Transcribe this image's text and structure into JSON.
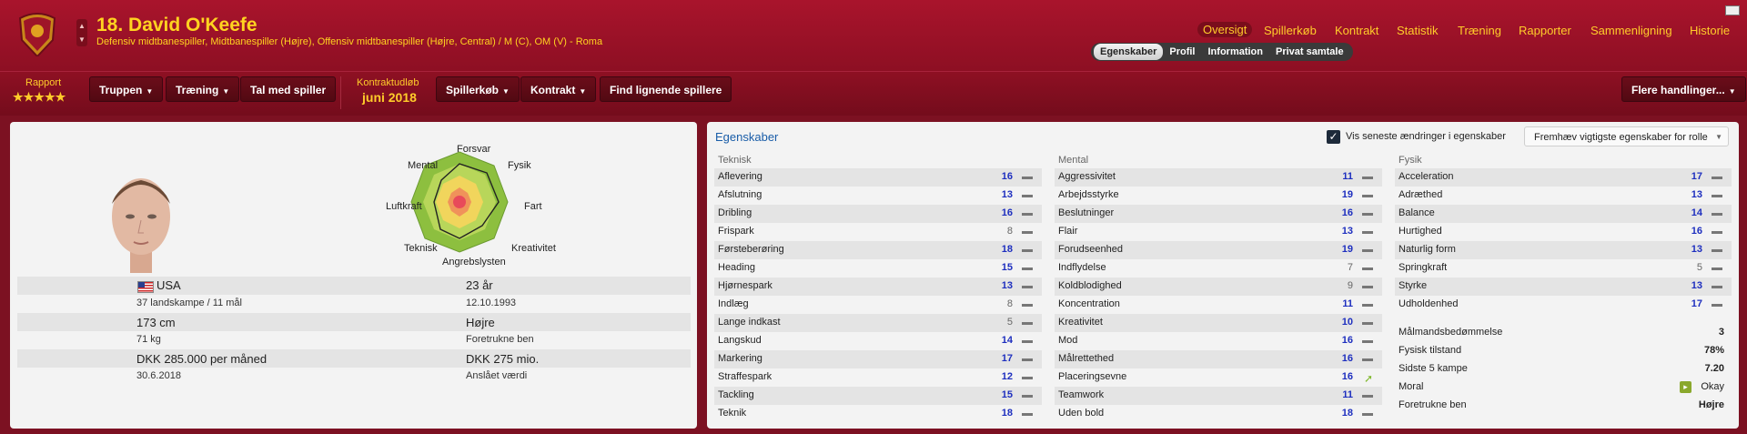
{
  "header": {
    "player_name": "18. David O'Keefe",
    "positions": "Defensiv midtbanespiller, Midtbanespiller (Højre), Offensiv midtbanespiller (Højre, Central) / M (C), OM (V) - Roma",
    "nav": [
      "Oversigt",
      "Spillerkøb",
      "Kontrakt",
      "Statistik",
      "Træning",
      "Rapporter",
      "Sammenligning",
      "Historie"
    ],
    "active_nav": "Oversigt",
    "subtabs": [
      "Egenskaber",
      "Profil",
      "Information",
      "Privat samtale"
    ],
    "active_subtab": "Egenskaber"
  },
  "action_bar": {
    "rapport_label": "Rapport",
    "rapport_stars": "★★★★★",
    "buttons_left": [
      "Truppen",
      "Træning",
      "Tal med spiller"
    ],
    "kontrakt_label": "Kontraktudløb",
    "kontrakt_value": "juni 2018",
    "buttons_right": [
      "Spillerkøb",
      "Kontrakt",
      "Find lignende spillere"
    ],
    "more_actions": "Flere handlinger..."
  },
  "profile": {
    "radar_labels": [
      "Forsvar",
      "Fysik",
      "Fart",
      "Kreativitet",
      "Angrebslysten",
      "Teknisk",
      "Luftkraft",
      "Mental"
    ],
    "nationality": "USA",
    "caps": "37 landskampe / 11 mål",
    "age": "23 år",
    "birthdate": "12.10.1993",
    "height": "173 cm",
    "weight": "71 kg",
    "foot": "Højre",
    "foot_label": "Foretrukne ben",
    "wage": "DKK 285.000 per måned",
    "contract_end": "30.6.2018",
    "value": "DKK 275 mio.",
    "value_label": "Anslået værdi"
  },
  "attributes": {
    "title": "Egenskaber",
    "show_changes": "Vis seneste ændringer i egenskaber",
    "highlight": "Fremhæv vigtigste egenskaber for rolle",
    "teknisk_header": "Teknisk",
    "mental_header": "Mental",
    "fysik_header": "Fysik",
    "teknisk": [
      {
        "name": "Aflevering",
        "value": "16"
      },
      {
        "name": "Afslutning",
        "value": "13"
      },
      {
        "name": "Dribling",
        "value": "16"
      },
      {
        "name": "Frispark",
        "value": "8"
      },
      {
        "name": "Førsteberøring",
        "value": "18"
      },
      {
        "name": "Heading",
        "value": "15"
      },
      {
        "name": "Hjørnespark",
        "value": "13"
      },
      {
        "name": "Indlæg",
        "value": "8"
      },
      {
        "name": "Lange indkast",
        "value": "5"
      },
      {
        "name": "Langskud",
        "value": "14"
      },
      {
        "name": "Markering",
        "value": "17"
      },
      {
        "name": "Straffespark",
        "value": "12"
      },
      {
        "name": "Tackling",
        "value": "15"
      },
      {
        "name": "Teknik",
        "value": "18"
      }
    ],
    "mental": [
      {
        "name": "Aggressivitet",
        "value": "11"
      },
      {
        "name": "Arbejdsstyrke",
        "value": "19"
      },
      {
        "name": "Beslutninger",
        "value": "16"
      },
      {
        "name": "Flair",
        "value": "13"
      },
      {
        "name": "Forudseenhed",
        "value": "19"
      },
      {
        "name": "Indflydelse",
        "value": "7"
      },
      {
        "name": "Koldblodighed",
        "value": "9"
      },
      {
        "name": "Koncentration",
        "value": "11"
      },
      {
        "name": "Kreativitet",
        "value": "10"
      },
      {
        "name": "Mod",
        "value": "16"
      },
      {
        "name": "Målrettethed",
        "value": "16"
      },
      {
        "name": "Placeringsevne",
        "value": "16"
      },
      {
        "name": "Teamwork",
        "value": "11"
      },
      {
        "name": "Uden bold",
        "value": "18"
      }
    ],
    "fysik": [
      {
        "name": "Acceleration",
        "value": "17"
      },
      {
        "name": "Adræthed",
        "value": "13"
      },
      {
        "name": "Balance",
        "value": "14"
      },
      {
        "name": "Hurtighed",
        "value": "16"
      },
      {
        "name": "Naturlig form",
        "value": "13"
      },
      {
        "name": "Springkraft",
        "value": "5"
      },
      {
        "name": "Styrke",
        "value": "13"
      },
      {
        "name": "Udholdenhed",
        "value": "17"
      }
    ],
    "summary": [
      {
        "name": "Målmandsbedømmelse",
        "value": "3"
      },
      {
        "name": "Fysisk tilstand",
        "value": "78%"
      },
      {
        "name": "Sidste 5 kampe",
        "value": "7.20"
      },
      {
        "name": "Moral",
        "value": "Okay"
      },
      {
        "name": "Foretrukne ben",
        "value": "Højre"
      }
    ]
  },
  "colors": {
    "header": "#a9142c",
    "accent_yellow": "#ffcc2a",
    "value_blue": "#1e2fbf",
    "moral_icon": "#8aa82c"
  }
}
